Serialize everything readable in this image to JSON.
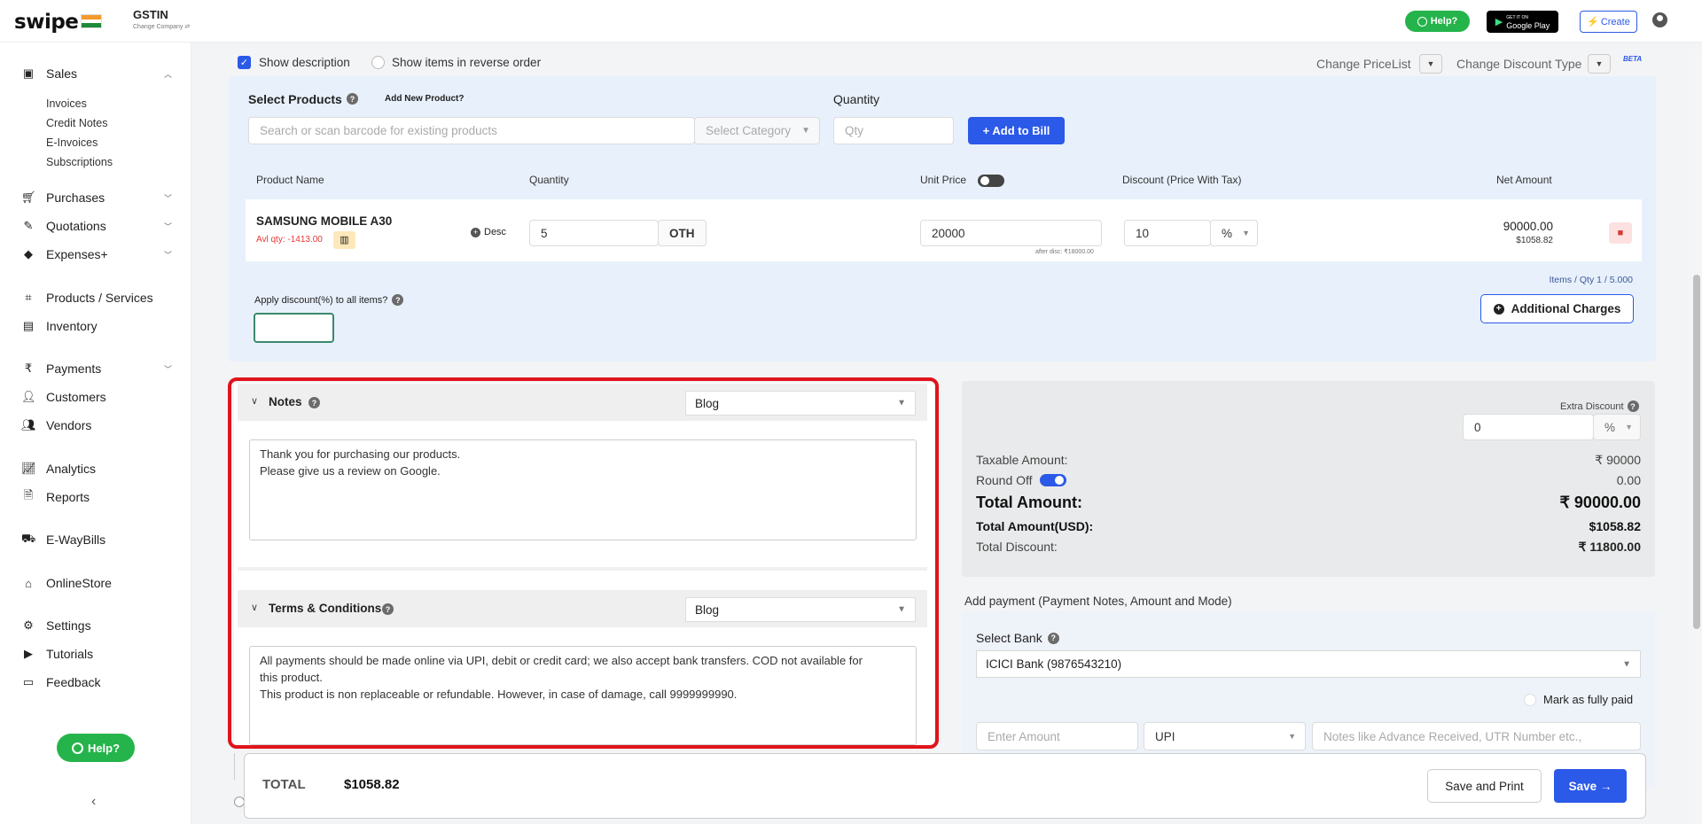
{
  "header": {
    "logo": "swipe",
    "company_name": "GSTIN",
    "change_company": "Change Company ⇄",
    "help_label": "Help?",
    "gplay_small": "GET IT ON",
    "gplay_label": "Google Play",
    "create_label": "Create"
  },
  "sidebar": {
    "sales": "Sales",
    "sales_sub": [
      "Invoices",
      "Credit Notes",
      "E-Invoices",
      "Subscriptions"
    ],
    "items": [
      "Purchases",
      "Quotations",
      "Expenses+",
      "Products / Services",
      "Inventory",
      "Payments",
      "Customers",
      "Vendors",
      "Analytics",
      "Reports",
      "E-WayBills",
      "OnlineStore",
      "Settings",
      "Tutorials",
      "Feedback"
    ],
    "help_label": "Help?",
    "collapse": "‹"
  },
  "options": {
    "show_description": "Show description",
    "show_reverse": "Show items in reverse order",
    "change_pricelist": "Change PriceList",
    "change_discount_type": "Change Discount Type",
    "beta": "BETA"
  },
  "products": {
    "select_products": "Select Products",
    "add_new_product": "Add New Product?",
    "quantity_label": "Quantity",
    "search_placeholder": "Search or scan barcode for existing products",
    "category_placeholder": "Select Category",
    "qty_placeholder": "Qty",
    "add_to_bill": "+ Add to Bill",
    "columns": {
      "product_name": "Product Name",
      "quantity": "Quantity",
      "unit_price": "Unit Price",
      "discount": "Discount (Price With Tax)",
      "net_amount": "Net Amount"
    },
    "row": {
      "name": "SAMSUNG MOBILE A30",
      "avl_qty": "Avl qty: -1413.00",
      "desc": "Desc",
      "quantity": "5",
      "unit": "OTH",
      "unit_price": "20000",
      "after_disc": "after disc: ₹18000.00",
      "discount": "10",
      "discount_type": "%",
      "net_amount": "90000.00",
      "net_amount_usd": "$1058.82"
    },
    "items_qty": "Items / Qty 1 / 5.000",
    "apply_discount": "Apply discount(%) to all items?",
    "additional_charges": "Additional Charges"
  },
  "notes": {
    "title": "Notes",
    "template": "Blog",
    "line1": "Thank you for purchasing our products.",
    "line2": "Please give us a review on Google."
  },
  "terms": {
    "title": "Terms & Conditions",
    "template": "Blog",
    "line1": "All payments should be made online via UPI, debit or credit card; we also accept bank transfers. COD not available for",
    "line2": "this product.",
    "line3": "This product is non replaceable or refundable. However, in case of damage, call 9999999990."
  },
  "summary": {
    "extra_discount": "Extra Discount",
    "extra_discount_value": "0",
    "extra_discount_type": "%",
    "taxable_label": "Taxable Amount:",
    "taxable_value": "₹ 90000",
    "round_off_label": "Round Off",
    "round_off_value": "0.00",
    "total_label": "Total Amount:",
    "total_value": "₹ 90000.00",
    "total_usd_label": "Total Amount(USD):",
    "total_usd_value": "$1058.82",
    "total_discount_label": "Total Discount:",
    "total_discount_value": "₹ 11800.00"
  },
  "payment": {
    "heading": "Add payment (Payment Notes, Amount and Mode)",
    "select_bank": "Select Bank",
    "bank": "ICICI Bank (9876543210)",
    "mark_paid": "Mark as fully paid",
    "amount_placeholder": "Enter Amount",
    "mode": "UPI",
    "notes_placeholder": "Notes like Advance Received, UTR Number etc.,"
  },
  "footer": {
    "total_label": "TOTAL",
    "total_value": "$1058.82",
    "save_print": "Save and Print",
    "save": "Save →"
  },
  "colors": {
    "accent": "#2b59e8",
    "help_green": "#25b44b",
    "highlight_red": "#e0141c"
  }
}
